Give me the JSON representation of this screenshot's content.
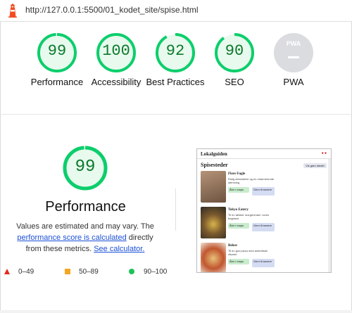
{
  "browser": {
    "url": "http://127.0.0.1:5500/01_kodet_site/spise.html"
  },
  "summary": [
    {
      "label": "Performance",
      "score": "99",
      "value": 0.99
    },
    {
      "label": "Accessibility",
      "score": "100",
      "value": 1.0
    },
    {
      "label": "Best Practices",
      "score": "92",
      "value": 0.92
    },
    {
      "label": "SEO",
      "score": "90",
      "value": 0.9
    },
    {
      "label": "PWA",
      "score": "",
      "value": 0
    }
  ],
  "pwa_badge": "PWA",
  "detail": {
    "score": "99",
    "title": "Performance",
    "desc_pre": "Values are estimated and may vary. The",
    "link1": "performance score is calculated",
    "desc_mid": "directly from these metrics.",
    "link2": "See calculator."
  },
  "legend": [
    {
      "range": "0–49",
      "color": "#e12b1f",
      "shape": "triangle"
    },
    {
      "range": "50–89",
      "color": "#f5a623",
      "shape": "square"
    },
    {
      "range": "90–100",
      "color": "#1ec15a",
      "shape": "circle"
    }
  ],
  "preview": {
    "site_name": "Lokalguiden",
    "heading": "Spisesteder",
    "top_button": "Vis garn steder",
    "cards": [
      {
        "name": "Flere Fugle",
        "text": "Rolig atmosfære og en charmerende stemning",
        "open": "Åbn i maps",
        "go": "Gem til senere",
        "img": "#8a6b52"
      },
      {
        "name": "Tokyo Eatery",
        "text": "Til en lækker morgenmad i vores baghave",
        "open": "Åbn i maps",
        "go": "Gem til senere",
        "img": "#5d4a34"
      },
      {
        "name": "Behov",
        "text": "Til en god pizza med autentiske råvarer",
        "open": "Åbn i maps",
        "go": "Gem til senere",
        "img": "#c0562f"
      }
    ]
  },
  "colors": {
    "pass": "#0cce6b",
    "pass_text": "#0b7a2b",
    "link": "#1a4fd6"
  }
}
